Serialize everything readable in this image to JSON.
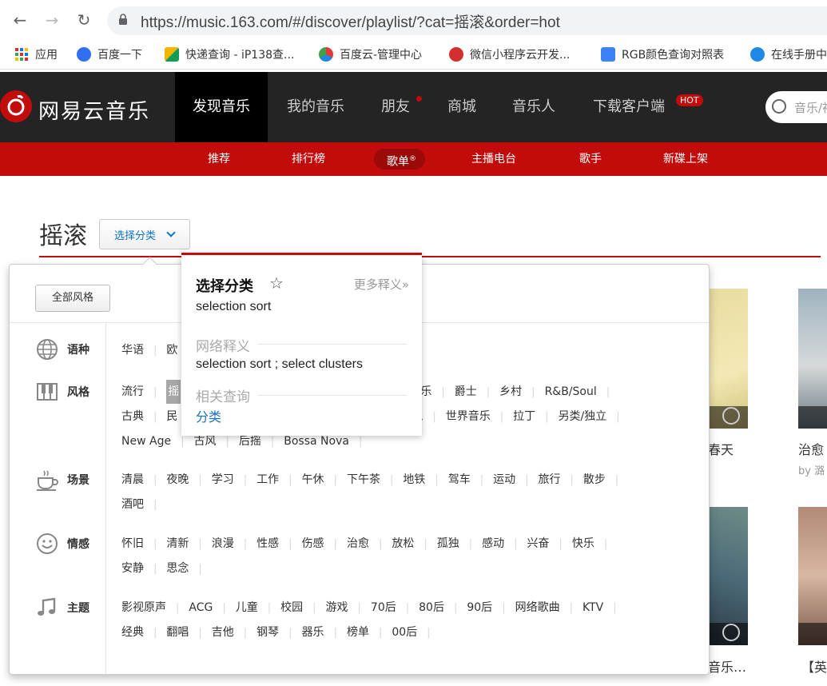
{
  "browser": {
    "url": "https://music.163.com/#/discover/playlist/?cat=摇滚&order=hot",
    "bookmarks": [
      "应用",
      "百度一下",
      "快递查询 - iP138查...",
      "百度云-管理中心",
      "微信小程序云开发...",
      "RGB颜色查询对照表",
      "在线手册中"
    ]
  },
  "header": {
    "logo": "网易云音乐",
    "nav": [
      "发现音乐",
      "我的音乐",
      "朋友",
      "商城",
      "音乐人",
      "下载客户端"
    ],
    "hot_badge": "HOT",
    "search_placeholder": "音乐/视"
  },
  "subnav": [
    "推荐",
    "排行榜",
    "歌单",
    "主播电台",
    "歌手",
    "新碟上架"
  ],
  "subnav_sup": "®",
  "page": {
    "title": "摇滚",
    "category_button": "选择分类"
  },
  "category_panel": {
    "all_styles": "全部风格",
    "rows": [
      {
        "label": "语种",
        "icon": "globe-icon",
        "tags": [
          "华语",
          "欧"
        ]
      },
      {
        "label": "风格",
        "icon": "piano-icon",
        "tags": [
          "流行",
          "摇",
          "轻音乐",
          "爵士",
          "乡村",
          "R&B/Soul",
          "古典",
          "民",
          "鬼",
          "世界音乐",
          "拉丁",
          "另类/独立",
          "New Age",
          "古风",
          "后摇",
          "Bossa Nova"
        ]
      },
      {
        "label": "场景",
        "icon": "coffee-cup-icon",
        "tags": [
          "清晨",
          "夜晚",
          "学习",
          "工作",
          "午休",
          "下午茶",
          "地铁",
          "驾车",
          "运动",
          "旅行",
          "散步",
          "酒吧"
        ]
      },
      {
        "label": "情感",
        "icon": "smiley-icon",
        "tags": [
          "怀旧",
          "清新",
          "浪漫",
          "性感",
          "伤感",
          "治愈",
          "放松",
          "孤独",
          "感动",
          "兴奋",
          "快乐",
          "安静",
          "思念"
        ]
      },
      {
        "label": "主题",
        "icon": "music-note-icon",
        "tags": [
          "影视原声",
          "ACG",
          "儿童",
          "校园",
          "游戏",
          "70后",
          "80后",
          "90后",
          "网络歌曲",
          "KTV",
          "经典",
          "翻唱",
          "吉他",
          "钢琴",
          "器乐",
          "榜单",
          "00后"
        ]
      }
    ]
  },
  "dictionary": {
    "word": "选择分类",
    "more": "更多释义»",
    "translation": "selection sort",
    "web_heading": "网络释义",
    "web_definition": "selection sort ; select clusters",
    "related_heading": "相关查询",
    "related_link": "分类"
  },
  "background": {
    "card_title_1": "春天",
    "card_title_2": "治愈",
    "card_by_2": "by 潞",
    "card_title_3": "音乐…",
    "card_title_4": "【英"
  }
}
